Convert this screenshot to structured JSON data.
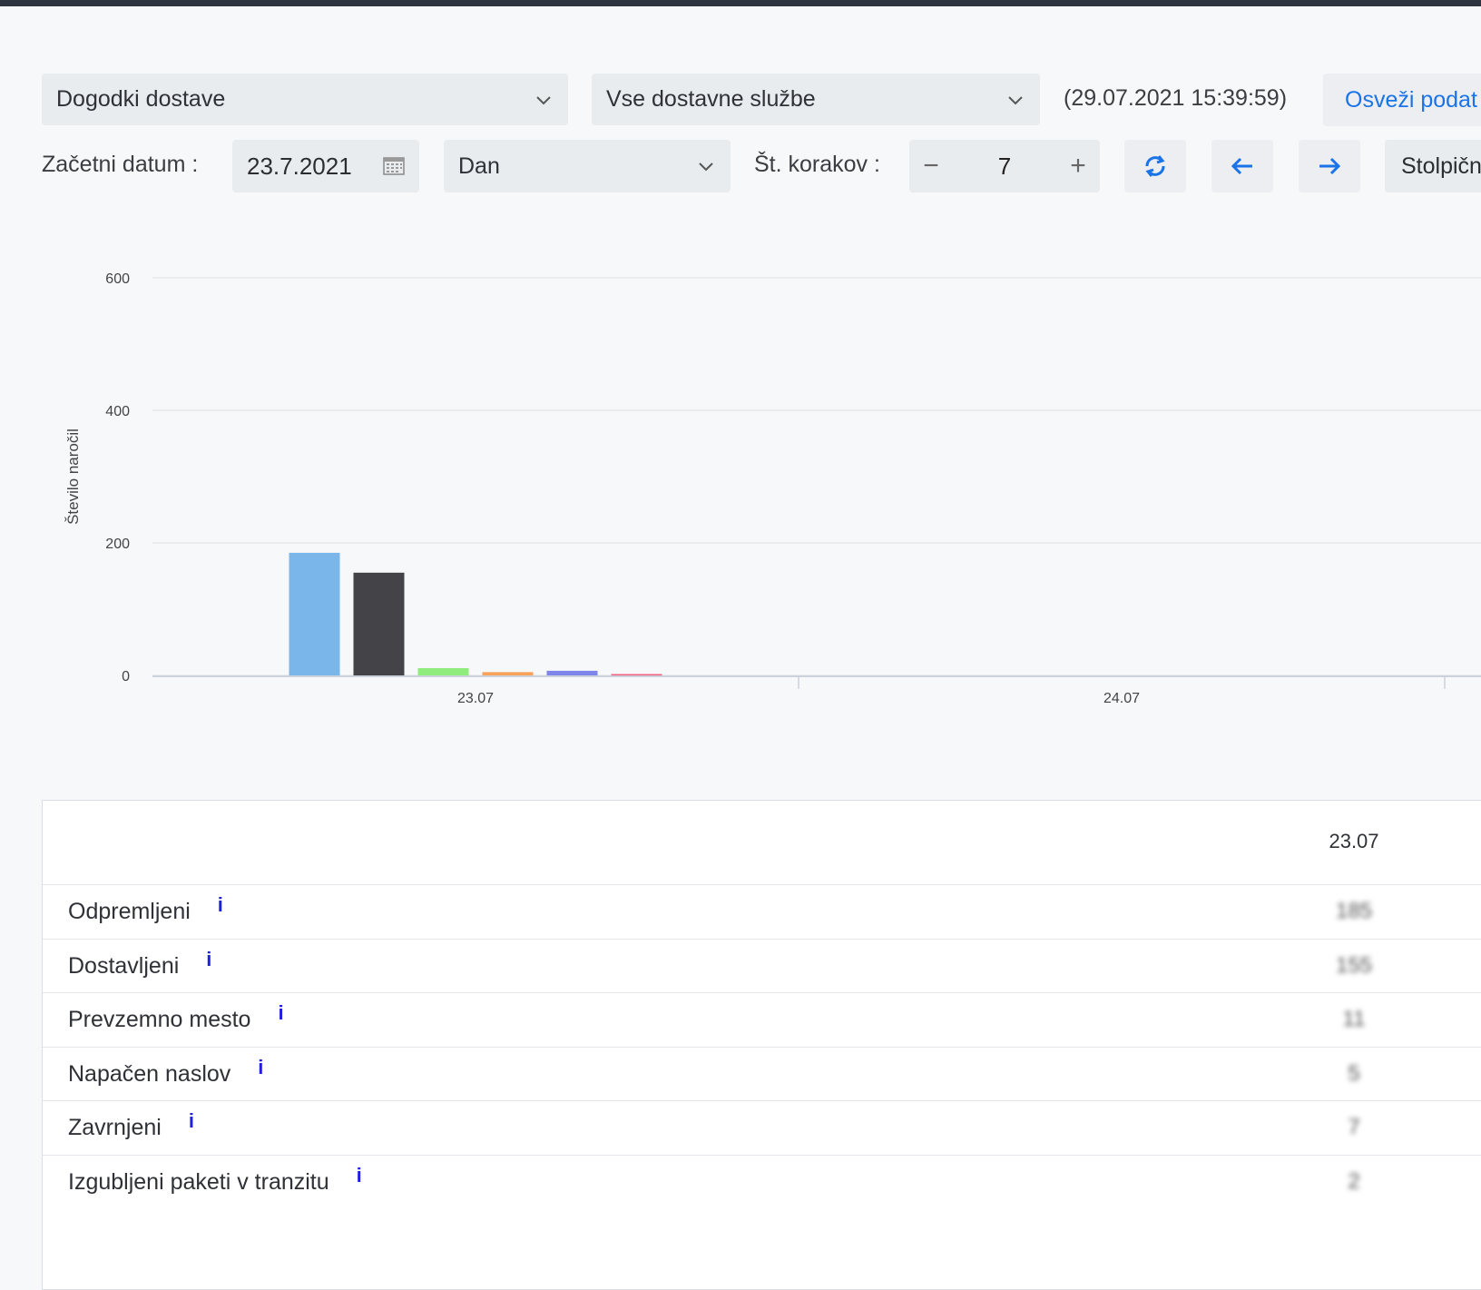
{
  "filters": {
    "event_type": "Dogodki dostave",
    "service": "Vse dostavne službe",
    "timestamp": "(29.07.2021 15:39:59)",
    "refresh_label": "Osveži podat"
  },
  "controls": {
    "start_label": "Začetni datum :",
    "start_date": "23.7.2021",
    "period": "Dan",
    "steps_label": "Št. korakov :",
    "steps_minus": "−",
    "steps_value": "7",
    "steps_plus": "+",
    "chart_type": "Stolpičn"
  },
  "colors": {
    "accent": "#1a73e8",
    "series": [
      "#7ab6ea",
      "#434348",
      "#90ed7d",
      "#f7a35c",
      "#8085e9",
      "#f15c80"
    ]
  },
  "chart_data": {
    "type": "bar",
    "ylabel": "Število naročil",
    "ylim": [
      0,
      600
    ],
    "yticks": [
      "600",
      "400",
      "200",
      "0"
    ],
    "categories": [
      "23.07",
      "24.07"
    ],
    "series": [
      {
        "name": "Odpremljeni",
        "values": [
          185,
          0
        ]
      },
      {
        "name": "Dostavljeni",
        "values": [
          155,
          0
        ]
      },
      {
        "name": "Prevzemno mesto",
        "values": [
          11,
          0
        ]
      },
      {
        "name": "Napačen naslov",
        "values": [
          5,
          0
        ]
      },
      {
        "name": "Zavrnjeni",
        "values": [
          7,
          0
        ]
      },
      {
        "name": "Izgubljeni paketi v tranzitu",
        "values": [
          2,
          0
        ]
      }
    ]
  },
  "table": {
    "column": "23.07",
    "rows": [
      {
        "label": "Odpremljeni",
        "value": "185"
      },
      {
        "label": "Dostavljeni",
        "value": "155"
      },
      {
        "label": "Prevzemno mesto",
        "value": "11"
      },
      {
        "label": "Napačen naslov",
        "value": "5"
      },
      {
        "label": "Zavrnjeni",
        "value": "7"
      },
      {
        "label": "Izgubljeni paketi v tranzitu",
        "value": "2"
      }
    ],
    "info_glyph": "i"
  }
}
